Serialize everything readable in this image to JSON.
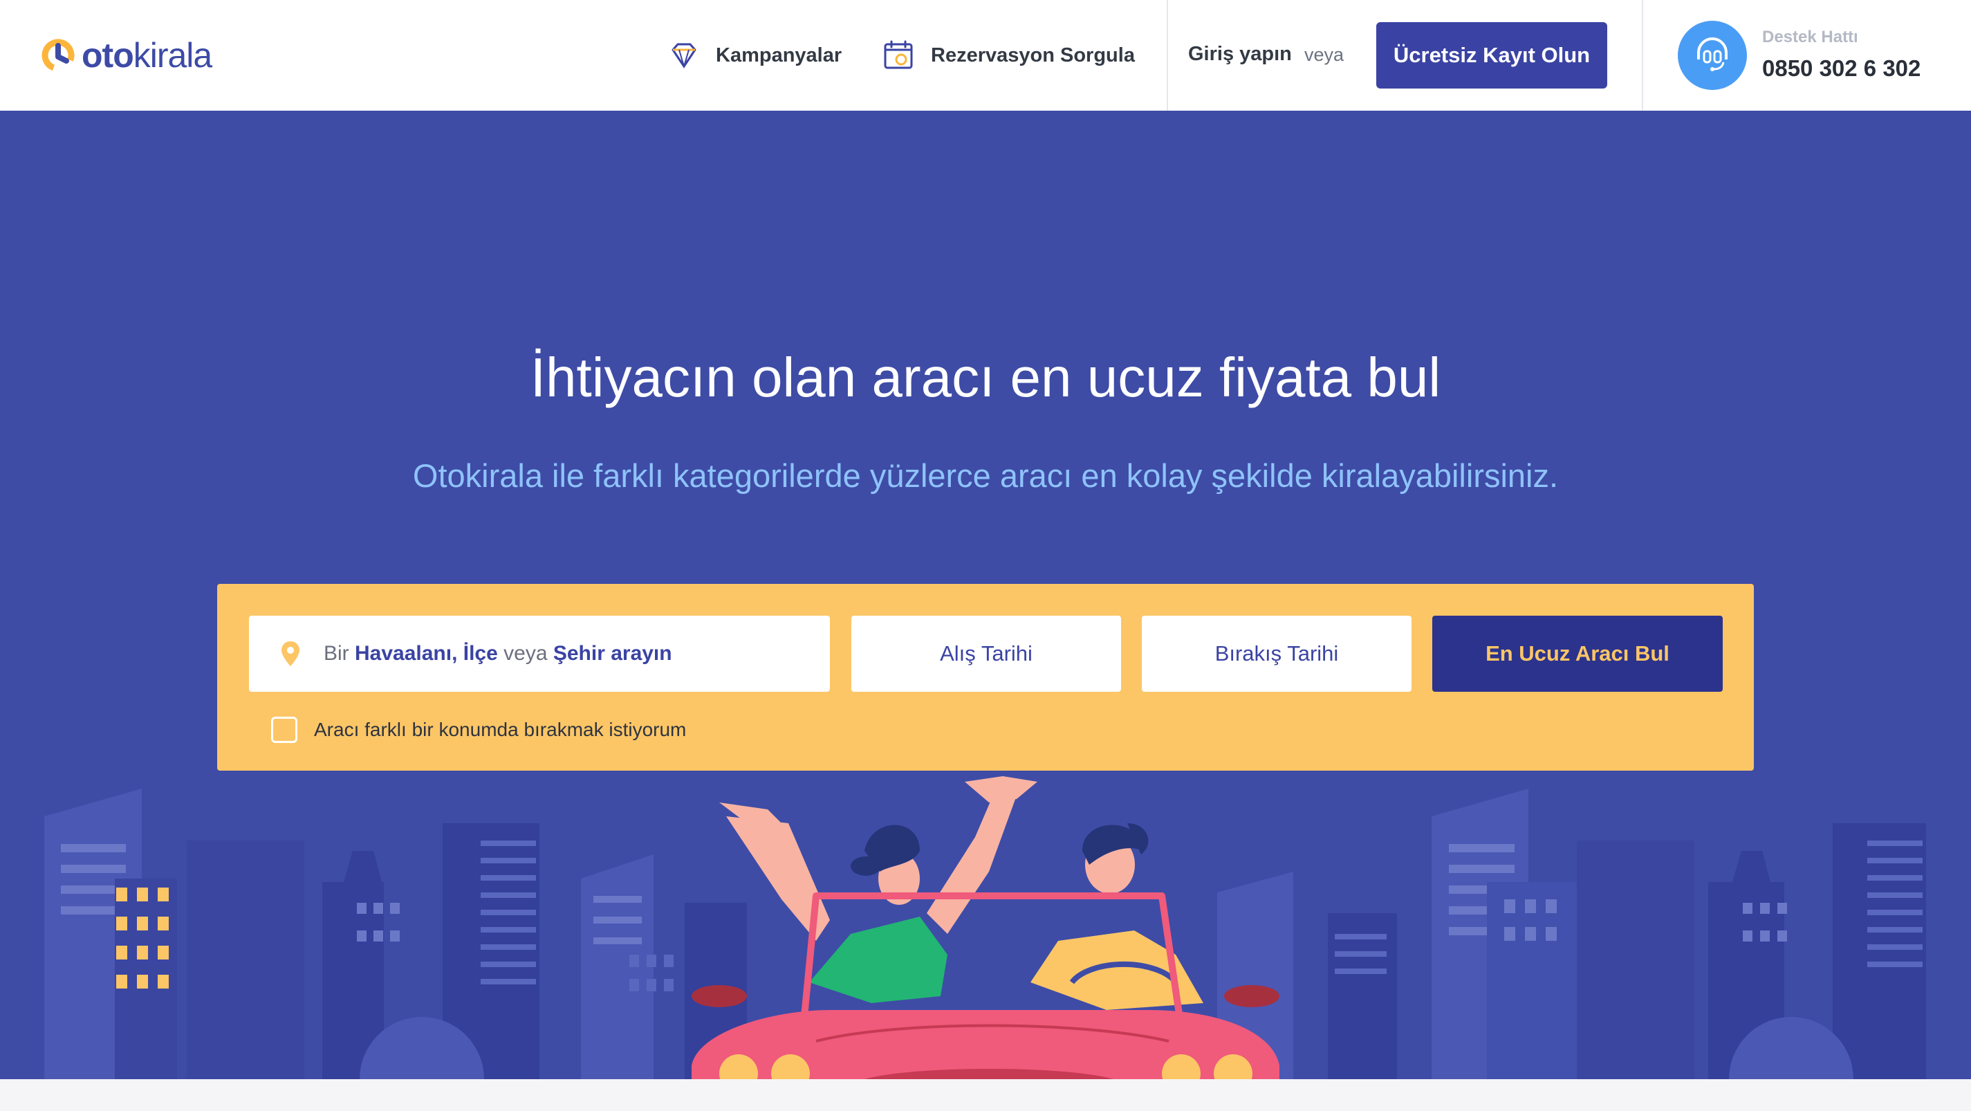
{
  "header": {
    "logo": {
      "bold": "oto",
      "light": "kirala"
    },
    "nav": [
      {
        "label": "Kampanyalar",
        "icon": "diamond-icon"
      },
      {
        "label": "Rezervasyon Sorgula",
        "icon": "calendar-search-icon"
      }
    ],
    "login_label": "Giriş yapın",
    "or_label": "veya",
    "signup_label": "Ücretsiz Kayıt Olun",
    "support": {
      "label": "Destek Hattı",
      "phone": "0850 302 6 302",
      "icon": "headset-icon"
    }
  },
  "hero": {
    "title": "İhtiyacın olan aracı en ucuz fiyata bul",
    "subtitle": "Otokirala ile farklı kategorilerde yüzlerce aracı en kolay şekilde kiralayabilirsiniz."
  },
  "search": {
    "location_placeholder": {
      "p1": "Bir ",
      "p2": "Havaalanı, İlçe",
      "p3": " veya ",
      "p4": "Şehir arayın"
    },
    "pickup_label": "Alış Tarihi",
    "dropoff_label": "Bırakış Tarihi",
    "submit_label": "En Ucuz Aracı Bul",
    "diff_location_label": "Aracı farklı bir konumda bırakmak istiyorum",
    "diff_location_checked": false
  },
  "colors": {
    "brand": "#3a43a3",
    "hero_bg": "#3e4ca6",
    "accent_yellow": "#fcc666",
    "subtitle": "#8fc3fb",
    "support_icon": "#4a9df5"
  }
}
